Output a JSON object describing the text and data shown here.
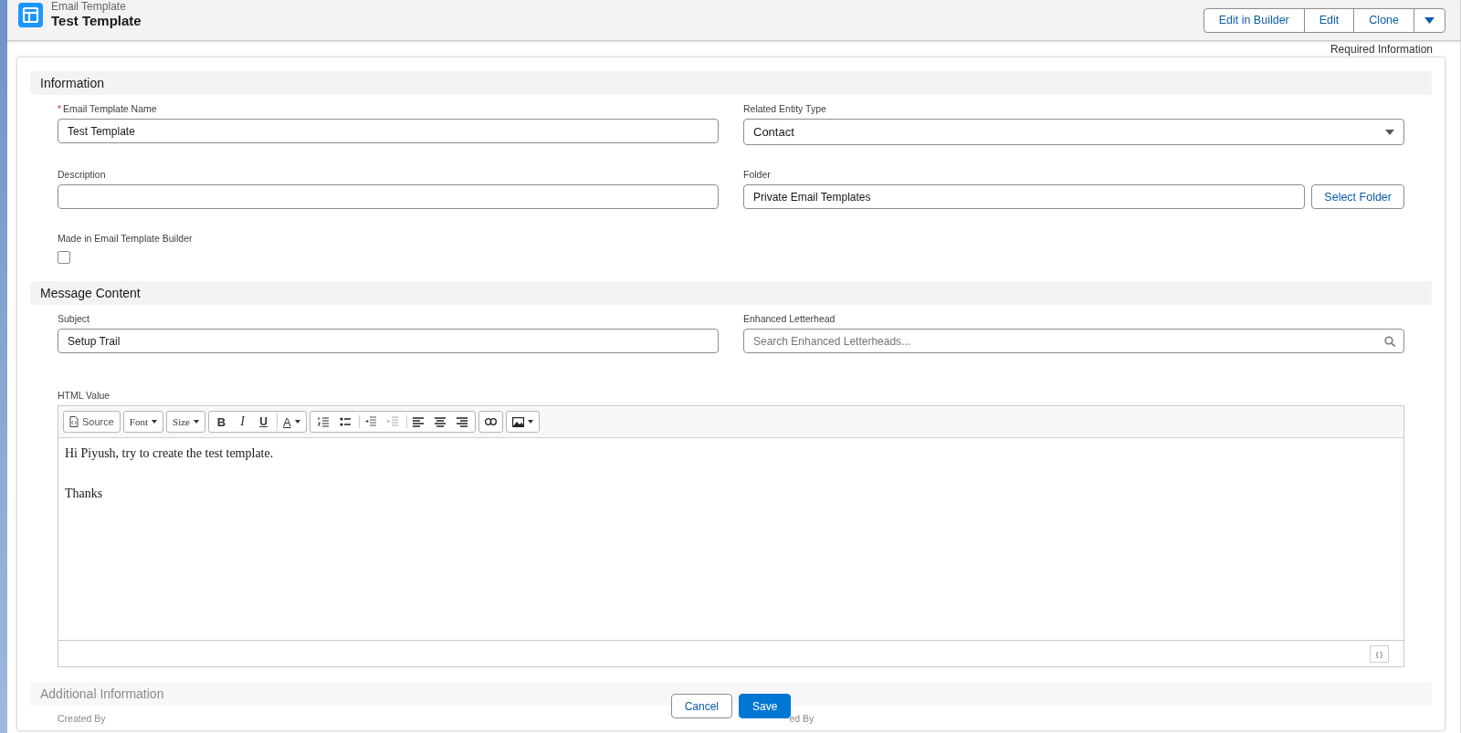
{
  "header": {
    "object_type": "Email Template",
    "title": "Test Template",
    "actions": [
      "Edit in Builder",
      "Edit",
      "Clone"
    ],
    "required_note": "Required Information"
  },
  "sections": [
    {
      "title": "Information"
    },
    {
      "title": "Message Content"
    },
    {
      "title": "Additional Information"
    }
  ],
  "fields": {
    "name": {
      "label": "Email Template Name",
      "required": true,
      "required_mark": "*",
      "value": "Test Template"
    },
    "entity_type": {
      "label": "Related Entity Type",
      "value": "Contact"
    },
    "description": {
      "label": "Description"
    },
    "folder": {
      "label": "Folder",
      "value": "Private Email Templates",
      "button": "Select Folder"
    },
    "builder": {
      "label": "Made in Email Template Builder",
      "checked": false
    },
    "subject": {
      "label": "Subject",
      "value": "Setup Trail"
    },
    "letterhead": {
      "label": "Enhanced Letterhead",
      "placeholder": "Search Enhanced Letterheads..."
    },
    "html": {
      "label": "HTML Value",
      "lines": [
        "Hi Piyush, try to create the test template.",
        "Thanks"
      ],
      "merge_button": "{ }"
    }
  },
  "toolbar": [
    [
      {
        "kind": "source",
        "label": "Source"
      }
    ],
    [
      {
        "kind": "dropdown",
        "label": "Font"
      }
    ],
    [
      {
        "kind": "dropdown",
        "label": "Size"
      }
    ],
    [
      {
        "kind": "bold",
        "label": "B"
      },
      {
        "kind": "italic",
        "label": "I"
      },
      {
        "kind": "underline",
        "label": "U"
      },
      {
        "kind": "color",
        "label": "A"
      }
    ],
    [
      {
        "kind": "numbered"
      },
      {
        "kind": "bulleted"
      },
      {
        "kind": "indent"
      },
      {
        "kind": "outdent"
      },
      {
        "kind": "left"
      },
      {
        "kind": "center"
      },
      {
        "kind": "right"
      }
    ],
    [
      {
        "kind": "link"
      }
    ],
    [
      {
        "kind": "image"
      }
    ]
  ],
  "footer_faded": [
    "Created By",
    "ed By"
  ],
  "buttons": [
    "Cancel",
    "Save"
  ]
}
